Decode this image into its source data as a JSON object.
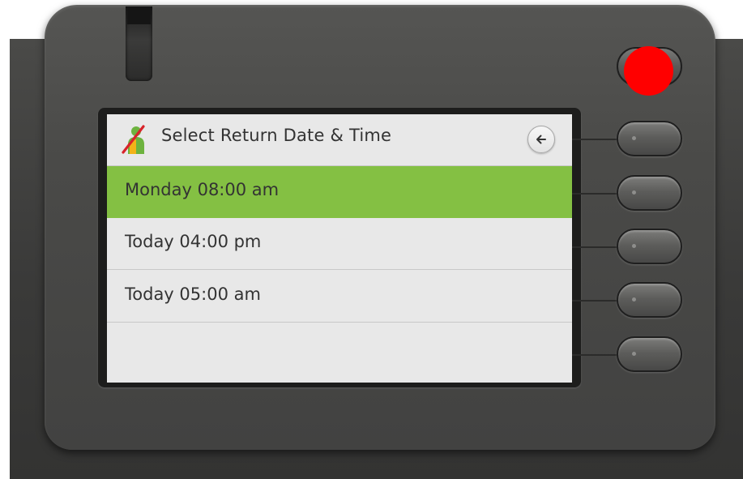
{
  "screen": {
    "header": {
      "title": "Select Return Date & Time",
      "icon": "user-unavailable-icon",
      "back_icon": "back-arrow-icon"
    },
    "items": [
      {
        "label": "Monday  08:00 am",
        "selected": true
      },
      {
        "label": "Today  04:00 pm",
        "selected": false
      },
      {
        "label": "Today  05:00 am",
        "selected": false
      },
      {
        "label": "",
        "selected": false
      }
    ]
  },
  "hardware": {
    "softkeys": 5,
    "accent_color": "#84c043",
    "marker_color": "#ff0000"
  }
}
